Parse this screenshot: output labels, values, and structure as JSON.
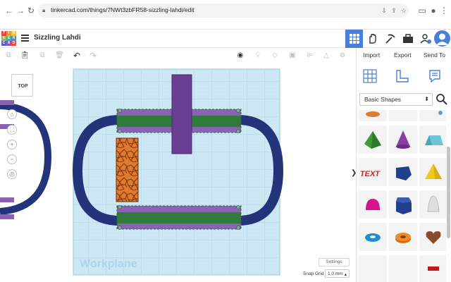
{
  "browser": {
    "url": "tinkercad.com/things/7NWt3zbFR58-sizzling-lahdi/edit"
  },
  "app": {
    "logo_letters": [
      "T",
      "I",
      "N",
      "K",
      "E",
      "R",
      "C",
      "A",
      "D"
    ],
    "logo_colors": [
      "#e8483f",
      "#f29a2e",
      "#f4c431",
      "#8dc24a",
      "#32b6b0",
      "#3d8fd6",
      "#5662c6",
      "#9c4fb5",
      "#e8483f"
    ],
    "design_title": "Sizzling Lahdi"
  },
  "panel": {
    "tabs": [
      "Import",
      "Export",
      "Send To"
    ],
    "shape_category": "Basic Shapes"
  },
  "canvas": {
    "viewcube_label": "TOP",
    "workplane_label": "Workplane",
    "settings_label": "Settings",
    "snap_grid_label": "Snap Grid",
    "snap_grid_value": "1.0 mm",
    "snap_caret": "▴"
  },
  "colors": {
    "workplane": "#cde8f3",
    "grid": "#9fd0e8",
    "navy": "#23347a",
    "purple": "#8a63b4",
    "green": "#2f7b3c",
    "orange": "#e07a2e",
    "accent": "#4a7fd8"
  }
}
